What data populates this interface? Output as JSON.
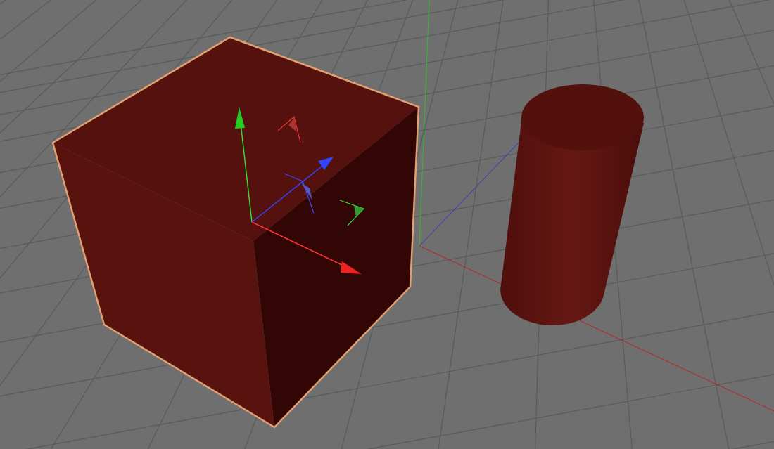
{
  "viewport": {
    "objects": [
      {
        "kind": "cube",
        "selected": true
      },
      {
        "kind": "cylinder",
        "selected": false
      }
    ]
  }
}
